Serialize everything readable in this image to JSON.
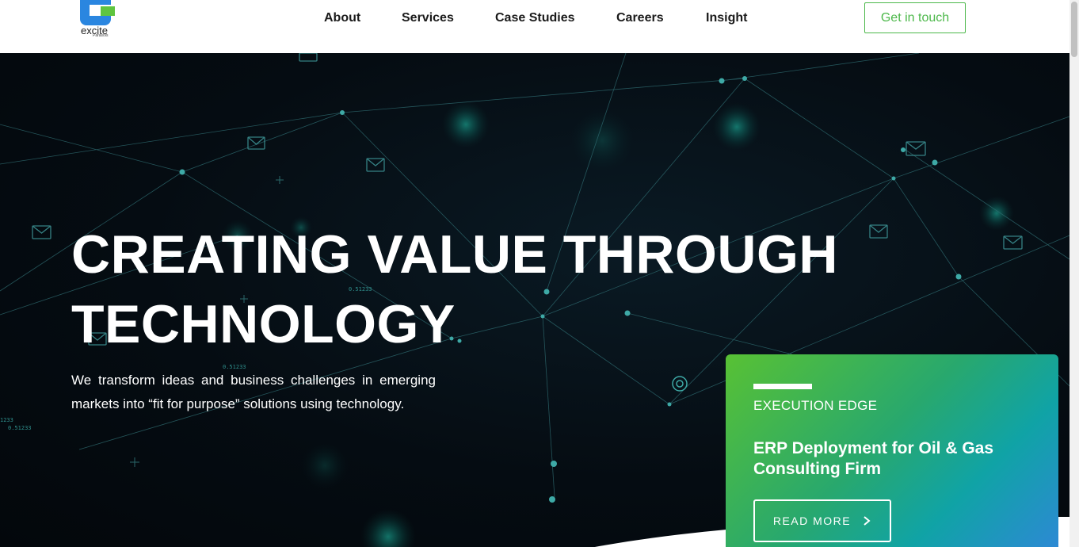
{
  "header": {
    "logo": {
      "wordmark": "excite",
      "subtext": "Parasols"
    },
    "nav": [
      {
        "label": "About"
      },
      {
        "label": "Services"
      },
      {
        "label": "Case Studies"
      },
      {
        "label": "Careers"
      },
      {
        "label": "Insight"
      }
    ],
    "cta_label": "Get in touch"
  },
  "hero": {
    "title_line1": "CREATING VALUE THROUGH",
    "title_line2": "TECHNOLOGY",
    "description": "We transform ideas and business challenges in emerging markets into “fit for purpose” solutions using technology.",
    "background_numbers": [
      "0.51233",
      "0.51233",
      "0.51233",
      "1233"
    ]
  },
  "card": {
    "eyebrow": "EXECUTION EDGE",
    "title": "ERP Deployment for Oil & Gas Consulting Firm",
    "button_label": "READ MORE",
    "button_icon": "chevron-right-icon"
  },
  "colors": {
    "brand_green": "#4cb84a",
    "brand_blue": "#2a86e0",
    "hero_bg": "#050c12",
    "card_gradient_start": "#58c134",
    "card_gradient_end": "#2f87d8"
  }
}
